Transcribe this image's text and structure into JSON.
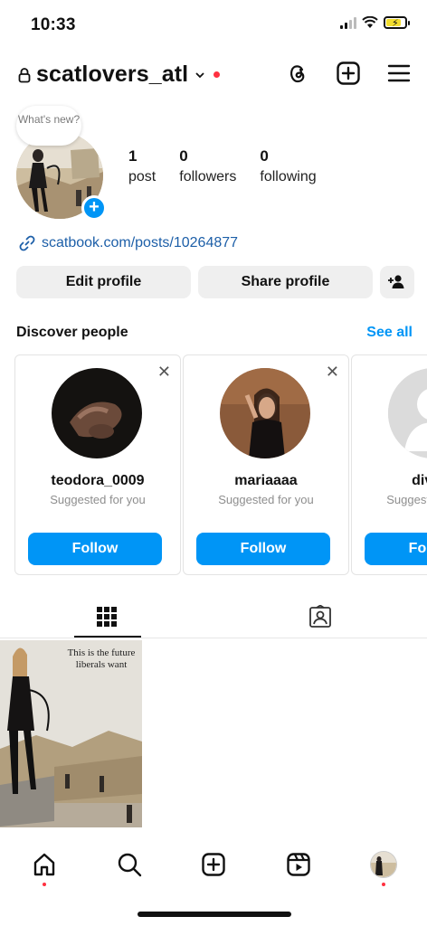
{
  "status_bar": {
    "time": "10:33",
    "battery_level": 0.8
  },
  "header": {
    "username": "scatlovers_atl",
    "icons": [
      "lock-icon",
      "chevron-down-icon",
      "threads-icon",
      "create-icon",
      "menu-icon"
    ]
  },
  "profile": {
    "note": "What's new?",
    "stats": [
      {
        "value": "1",
        "label": "post"
      },
      {
        "value": "0",
        "label": "followers"
      },
      {
        "value": "0",
        "label": "following"
      }
    ],
    "link": "scatbook.com/posts/10264877"
  },
  "buttons": {
    "edit": "Edit profile",
    "share": "Share profile"
  },
  "discover": {
    "title": "Discover people",
    "see_all": "See all",
    "cards": [
      {
        "name": "teodora_0009",
        "sub": "Suggested for you",
        "follow": "Follow"
      },
      {
        "name": "mariaaaa",
        "sub": "Suggested for you",
        "follow": "Follow"
      },
      {
        "name": "divyay",
        "sub": "Suggested for you",
        "follow": "Follow"
      }
    ]
  },
  "post": {
    "caption": "This is the future liberals want"
  },
  "colors": {
    "accent": "#0095f6",
    "notification": "#ff3040",
    "link": "#1d5fa8"
  }
}
